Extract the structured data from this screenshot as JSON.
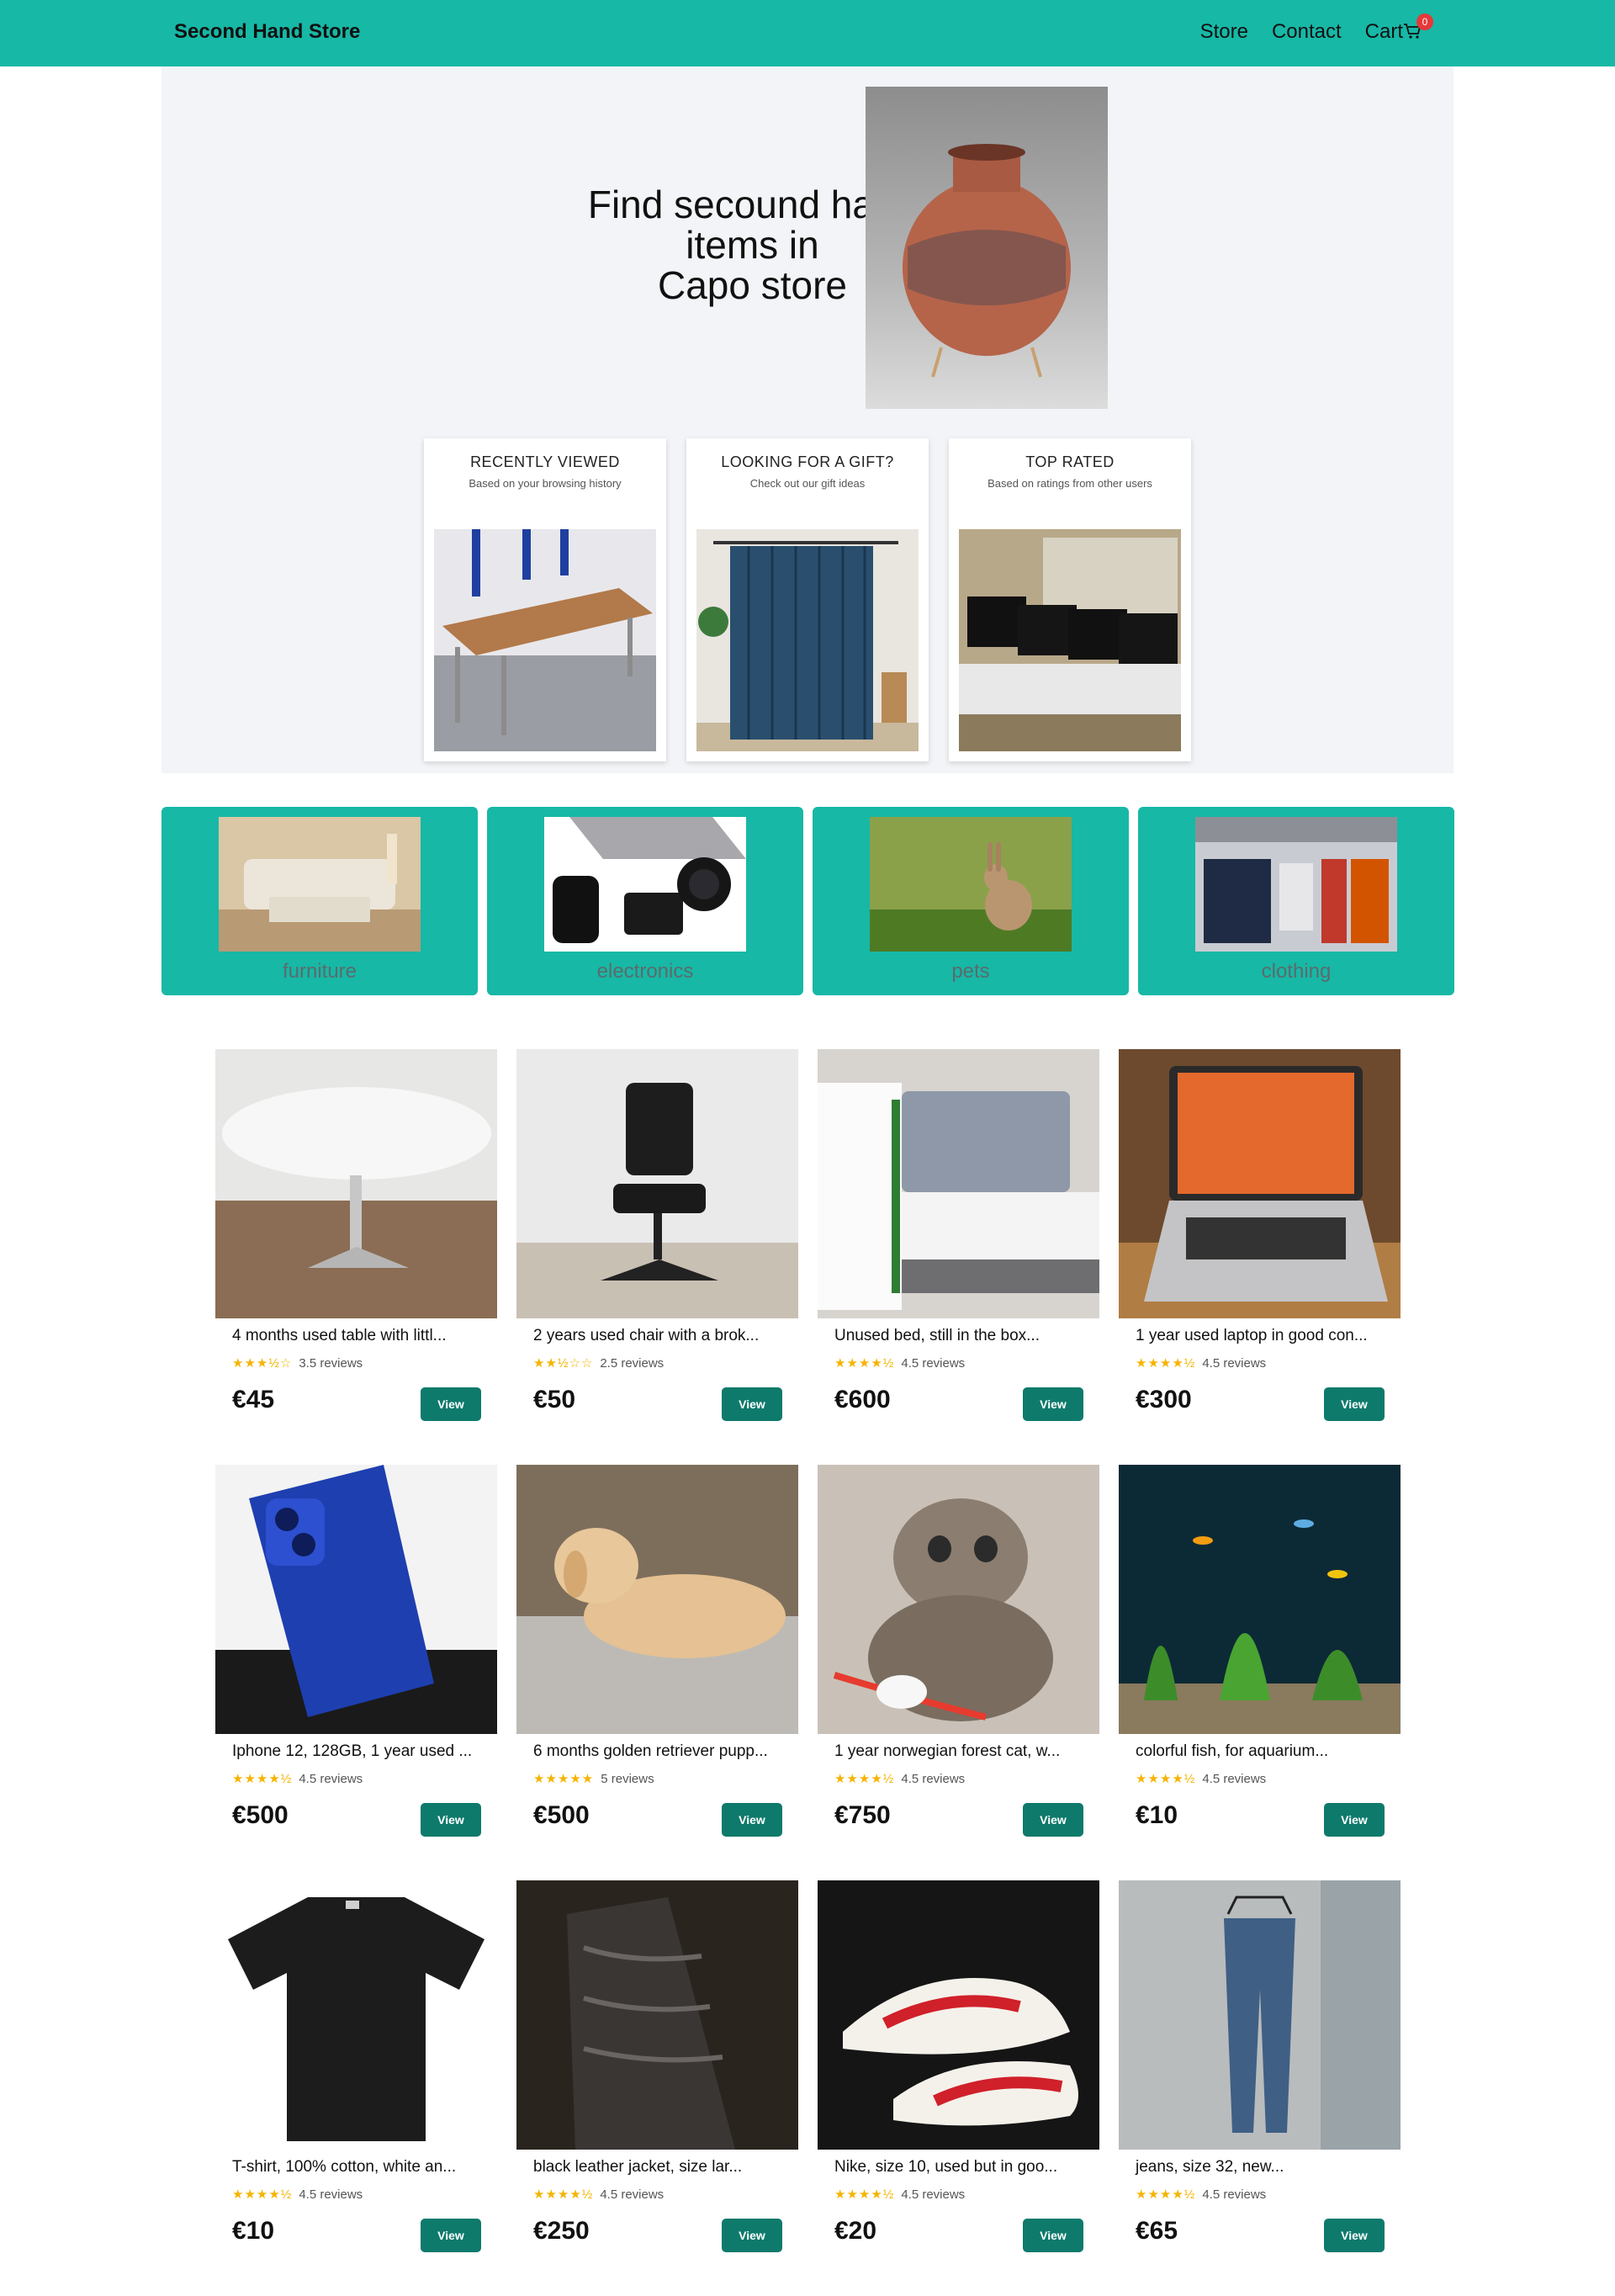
{
  "nav": {
    "brand": "Second Hand Store",
    "store": "Store",
    "contact": "Contact",
    "cart": "Cart",
    "cart_count": "0"
  },
  "hero": {
    "title_line1": "Find secound hand",
    "title_line2": "items in",
    "title_line3": "Capo store"
  },
  "features": [
    {
      "title": "RECENTLY VIEWED",
      "subtitle": "Based on your browsing history"
    },
    {
      "title": "LOOKING FOR A GIFT?",
      "subtitle": "Check out our gift ideas"
    },
    {
      "title": "TOP RATED",
      "subtitle": "Based on ratings from other users"
    }
  ],
  "categories": [
    {
      "label": "furniture"
    },
    {
      "label": "electronics"
    },
    {
      "label": "pets"
    },
    {
      "label": "clothing"
    }
  ],
  "products": [
    {
      "title": "4 months used table with littl...",
      "stars": "★★★½☆",
      "reviews": "3.5 reviews",
      "price": "€45",
      "button": "View"
    },
    {
      "title": "2 years used chair with a brok...",
      "stars": "★★½☆☆",
      "reviews": "2.5 reviews",
      "price": "€50",
      "button": "View"
    },
    {
      "title": "Unused bed, still in the box...",
      "stars": "★★★★½",
      "reviews": "4.5 reviews",
      "price": "€600",
      "button": "View"
    },
    {
      "title": "1 year used laptop in good con...",
      "stars": "★★★★½",
      "reviews": "4.5 reviews",
      "price": "€300",
      "button": "View"
    },
    {
      "title": "Iphone 12, 128GB, 1 year used ...",
      "stars": "★★★★½",
      "reviews": "4.5 reviews",
      "price": "€500",
      "button": "View"
    },
    {
      "title": "6 months golden retriever pupp...",
      "stars": "★★★★★",
      "reviews": "5 reviews",
      "price": "€500",
      "button": "View"
    },
    {
      "title": "1 year norwegian forest cat, w...",
      "stars": "★★★★½",
      "reviews": "4.5 reviews",
      "price": "€750",
      "button": "View"
    },
    {
      "title": "colorful fish, for aquarium...",
      "stars": "★★★★½",
      "reviews": "4.5 reviews",
      "price": "€10",
      "button": "View"
    },
    {
      "title": "T-shirt, 100% cotton, white an...",
      "stars": "★★★★½",
      "reviews": "4.5 reviews",
      "price": "€10",
      "button": "View"
    },
    {
      "title": "black leather jacket, size lar...",
      "stars": "★★★★½",
      "reviews": "4.5 reviews",
      "price": "€250",
      "button": "View"
    },
    {
      "title": "Nike, size 10, used but in goo...",
      "stars": "★★★★½",
      "reviews": "4.5 reviews",
      "price": "€20",
      "button": "View"
    },
    {
      "title": "jeans, size 32, new...",
      "stars": "★★★★½",
      "reviews": "4.5 reviews",
      "price": "€65",
      "button": "View"
    }
  ],
  "colors": {
    "accent": "#17b8a6",
    "button": "#0e7a6c",
    "badge": "#e5393a",
    "star": "#f5b400",
    "hero_bg": "#f2f4f7"
  }
}
